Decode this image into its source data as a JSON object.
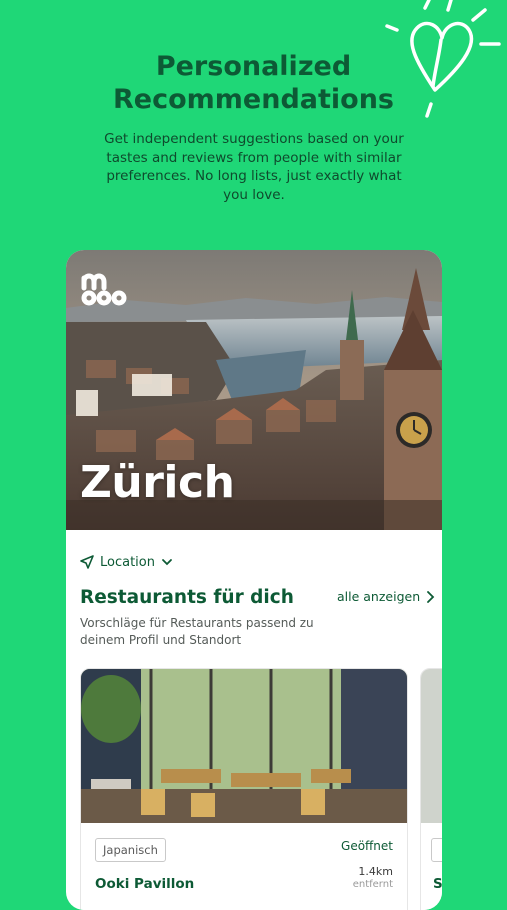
{
  "promo": {
    "headline_line1": "Personalized",
    "headline_line2": "Recommendations",
    "subtext": "Get independent suggestions based on your tastes and reviews from people with similar preferences. No long lists, just exactly what you love."
  },
  "app": {
    "hero": {
      "city": "Zürich",
      "logo": "my-logo"
    },
    "location_label": "Location",
    "section": {
      "title": "Restaurants für dich",
      "see_all": "alle anzeigen",
      "description": "Vorschläge für Restaurants passend zu deinem Profil und Standort"
    },
    "cards": [
      {
        "tag": "Japanisch",
        "status": "Geöffnet",
        "distance": "1.4km",
        "distance_suffix": "entfernt",
        "name": "Ooki Pavillon"
      },
      {
        "name_initial": "S"
      }
    ]
  },
  "colors": {
    "background": "#1fd777",
    "primary_text": "#0d5a35",
    "card_bg": "#ffffff"
  }
}
